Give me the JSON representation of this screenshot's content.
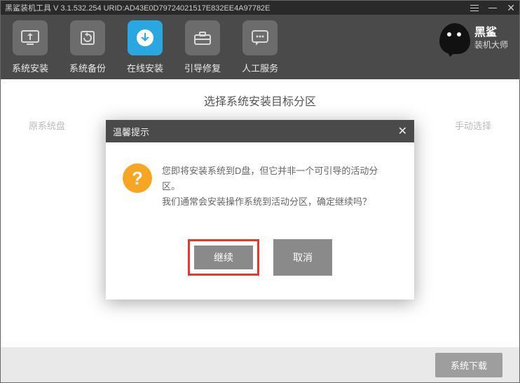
{
  "titlebar": {
    "text": "黑鲨装机工具 V 3.1.532.254 URID:AD43E0D79724021517E832EE4A97782E"
  },
  "logo": {
    "line1": "黑鲨",
    "line2": "装机大师"
  },
  "tabs": [
    {
      "label": "系统安装"
    },
    {
      "label": "系统备份"
    },
    {
      "label": "在线安装"
    },
    {
      "label": "引导修复"
    },
    {
      "label": "人工服务"
    }
  ],
  "page": {
    "heading": "选择系统安装目标分区",
    "hint_left": "原系统盘",
    "hint_right": "手动选择"
  },
  "modal": {
    "title": "温馨提示",
    "line1": "您即将安装系统到D盘，但它并非一个可引导的活动分区。",
    "line2": "我们通常会安装操作系统到活动分区，确定继续吗？",
    "continue_label": "继续",
    "cancel_label": "取消"
  },
  "footer": {
    "download_label": "系统下载"
  }
}
